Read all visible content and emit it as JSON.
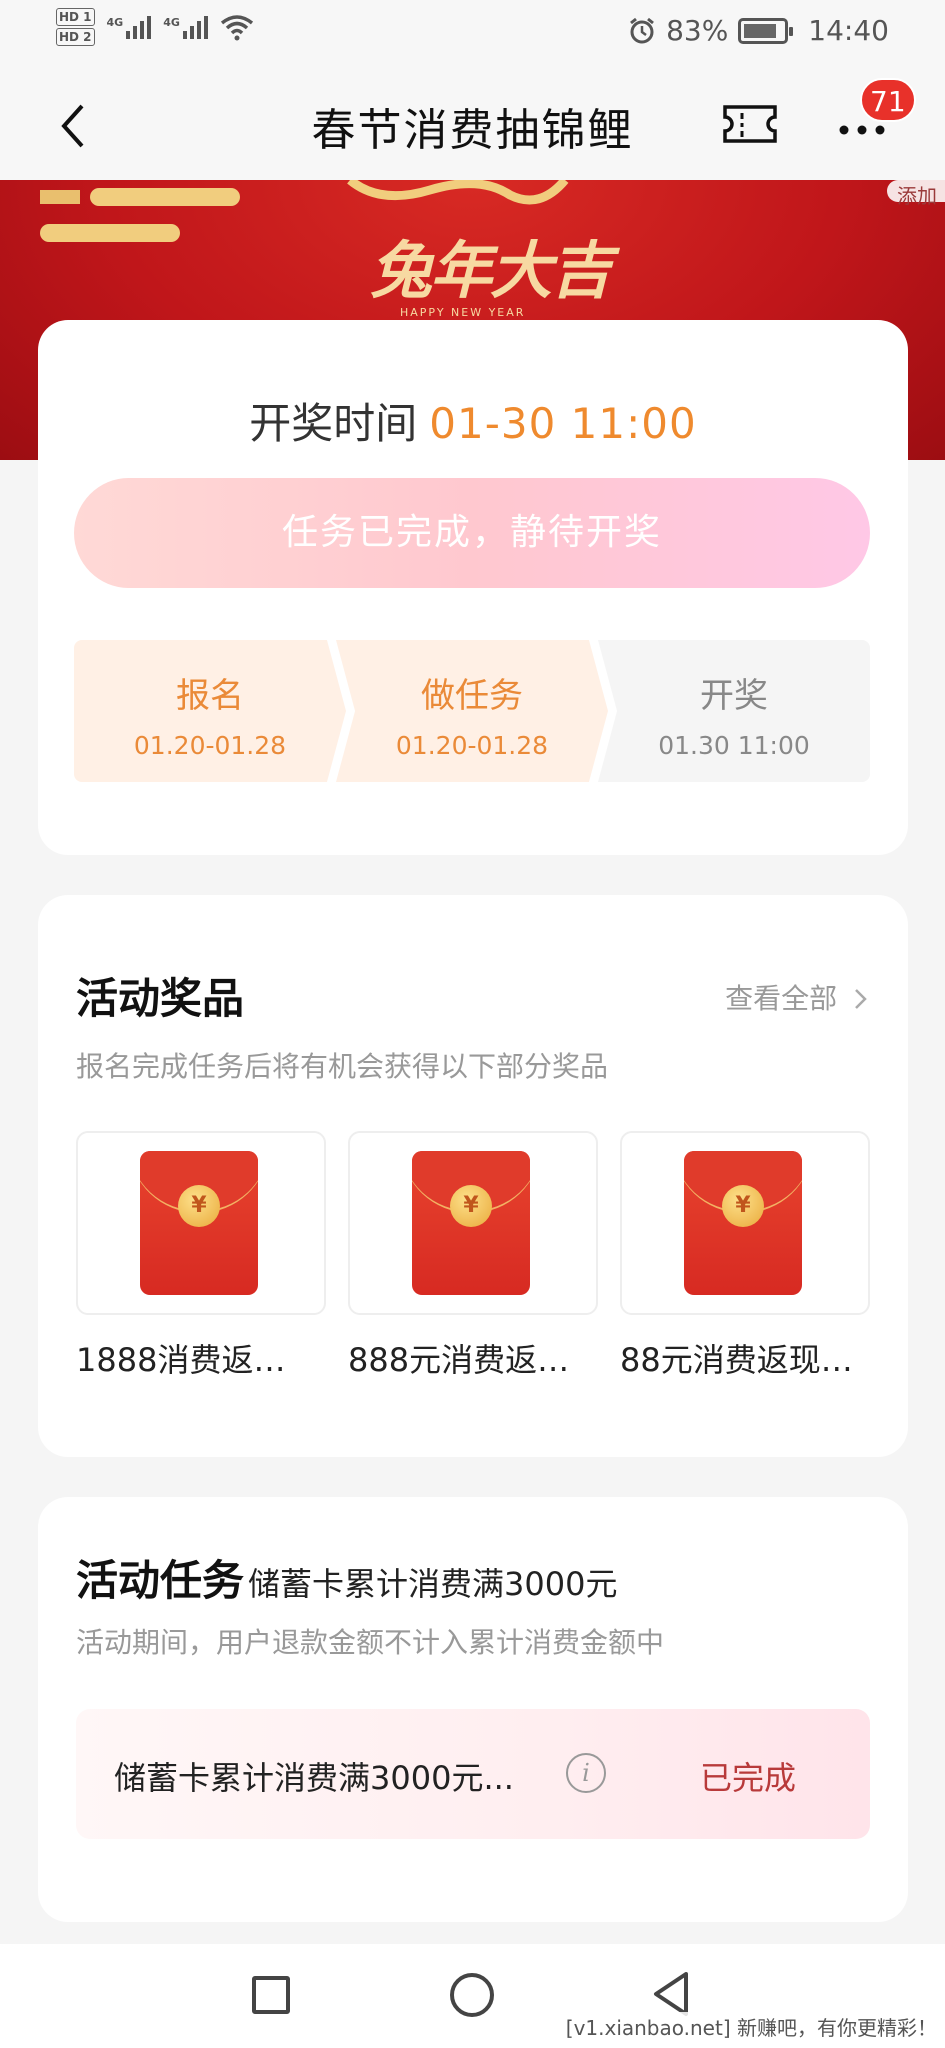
{
  "status_bar": {
    "hd1": "HD 1",
    "hd2": "HD 2",
    "net1": "4G",
    "net2": "4G",
    "battery": "83%",
    "battery_level": 0.83,
    "time": "14:40"
  },
  "nav": {
    "title": "春节消费抽锦鲤",
    "more_badge": "71"
  },
  "banner": {
    "text": "兔年大吉",
    "sub": "HAPPY NEW YEAR",
    "add_tag": "添加"
  },
  "draw": {
    "time_label": "开奖时间",
    "time_value": "01-30 11:00",
    "status_button": "任务已完成，静待开奖",
    "steps": [
      {
        "label": "报名",
        "date": "01.20-01.28"
      },
      {
        "label": "做任务",
        "date": "01.20-01.28"
      },
      {
        "label": "开奖",
        "date": "01.30 11:00"
      }
    ]
  },
  "prizes": {
    "title": "活动奖品",
    "see_all": "查看全部",
    "desc": "报名完成任务后将有机会获得以下部分奖品",
    "coin_symbol": "¥",
    "items": [
      {
        "name": "1888消费返…"
      },
      {
        "name": "888元消费返…"
      },
      {
        "name": "88元消费返现…"
      }
    ]
  },
  "tasks": {
    "title": "活动任务",
    "subtitle": "储蓄卡累计消费满3000元",
    "desc": "活动期间，用户退款金额不计入累计消费金额中",
    "item_name": "储蓄卡累计消费满3000元...",
    "info_glyph": "i",
    "item_status": "已完成"
  },
  "watermark": "[v1.xianbao.net] 新赚吧，有你更精彩！",
  "colors": {
    "accent_orange": "#ef8a2e",
    "status_red": "#b83a3a",
    "badge_red": "#e8312a",
    "banner_red": "#c0161a"
  }
}
